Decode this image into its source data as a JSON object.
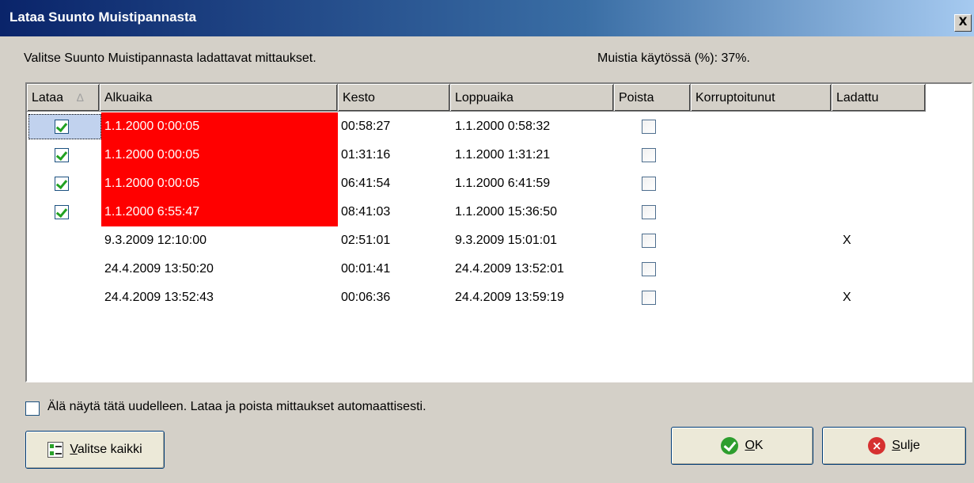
{
  "window": {
    "title": "Lataa Suunto Muistipannasta",
    "close_glyph": "X"
  },
  "intro_text": "Valitse Suunto Muistipannasta ladattavat mittaukset.",
  "memory_usage": "Muistia käytössä (%): 37%.",
  "columns": [
    "Lataa",
    "Alkuaika",
    "Kesto",
    "Loppuaika",
    "Poista",
    "Korruptoitunut",
    "Ladattu"
  ],
  "sort_indicator": "∆",
  "rows": [
    {
      "lataa": true,
      "alkuaika": "1.1.2000 0:00:05",
      "kesto": "00:58:27",
      "loppuaika": "1.1.2000 0:58:32",
      "poista": false,
      "korruptoitunut": "",
      "ladattu": "",
      "highlight": true
    },
    {
      "lataa": true,
      "alkuaika": "1.1.2000 0:00:05",
      "kesto": "01:31:16",
      "loppuaika": "1.1.2000 1:31:21",
      "poista": false,
      "korruptoitunut": "",
      "ladattu": "",
      "highlight": true
    },
    {
      "lataa": true,
      "alkuaika": "1.1.2000 0:00:05",
      "kesto": "06:41:54",
      "loppuaika": "1.1.2000 6:41:59",
      "poista": false,
      "korruptoitunut": "",
      "ladattu": "",
      "highlight": true
    },
    {
      "lataa": true,
      "alkuaika": "1.1.2000 6:55:47",
      "kesto": "08:41:03",
      "loppuaika": "1.1.2000 15:36:50",
      "poista": false,
      "korruptoitunut": "",
      "ladattu": "",
      "highlight": true
    },
    {
      "lataa": false,
      "alkuaika": "9.3.2009 12:10:00",
      "kesto": "02:51:01",
      "loppuaika": "9.3.2009 15:01:01",
      "poista": false,
      "korruptoitunut": "",
      "ladattu": "X",
      "highlight": false
    },
    {
      "lataa": false,
      "alkuaika": "24.4.2009 13:50:20",
      "kesto": "00:01:41",
      "loppuaika": "24.4.2009 13:52:01",
      "poista": false,
      "korruptoitunut": "",
      "ladattu": "",
      "highlight": false
    },
    {
      "lataa": false,
      "alkuaika": "24.4.2009 13:52:43",
      "kesto": "00:06:36",
      "loppuaika": "24.4.2009 13:59:19",
      "poista": false,
      "korruptoitunut": "",
      "ladattu": "X",
      "highlight": false
    }
  ],
  "dont_show_again": {
    "checked": false,
    "label": "Älä näytä tätä uudelleen. Lataa ja poista mittaukset automaattisesti."
  },
  "buttons": {
    "select_all": {
      "mnemonic": "V",
      "rest": "alitse kaikki"
    },
    "ok": {
      "mnemonic": "O",
      "rest": "K"
    },
    "close": {
      "mnemonic": "S",
      "rest": "ulje"
    }
  },
  "colors": {
    "highlight": "#ff0000",
    "title_start": "#0a246a",
    "dialog_bg": "#d4d0c8"
  }
}
